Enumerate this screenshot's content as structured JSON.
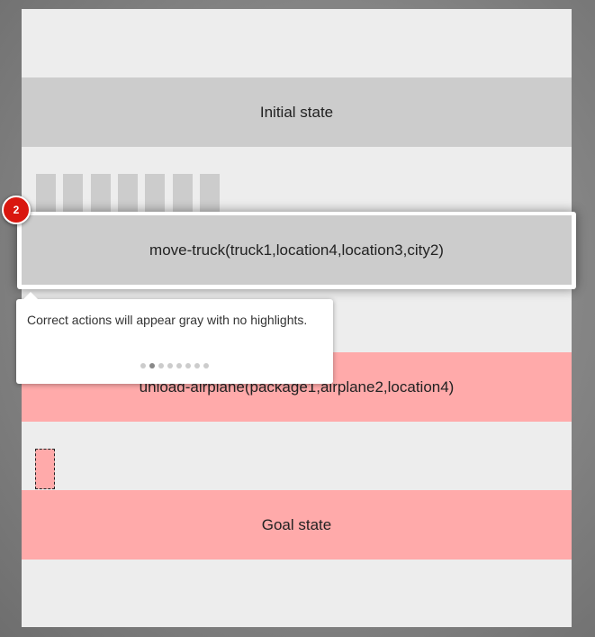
{
  "steps": {
    "initial_state": "Initial state",
    "action_1": "move-truck(truck1,location4,location3,city2)",
    "action_2": "unload-airplane(package1,airplane2,location4)",
    "goal_state": "Goal state"
  },
  "tour": {
    "badge_number": "2",
    "tooltip_text": "Correct actions will appear gray with no highlights.",
    "total_steps": 8,
    "current_step": 2
  },
  "colors": {
    "correct": "#cccccc",
    "error": "#ffaaaa",
    "badge": "#d9170f"
  }
}
